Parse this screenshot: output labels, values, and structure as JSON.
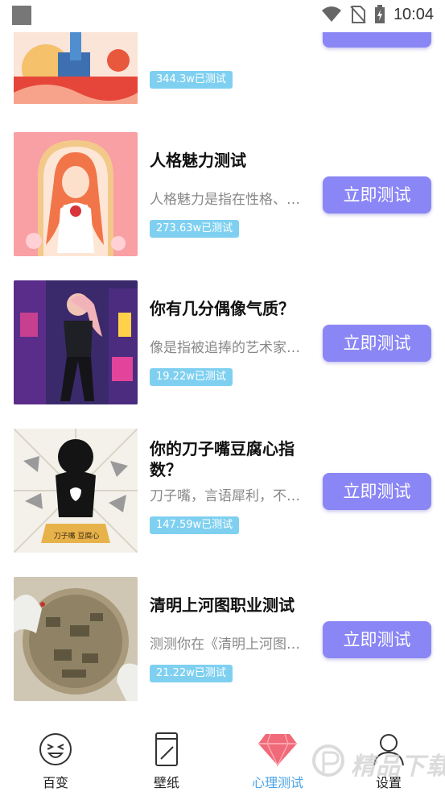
{
  "status_bar": {
    "time": "10:04"
  },
  "tests": [
    {
      "title": "",
      "desc": "",
      "count": "344.3w已测试",
      "button": ""
    },
    {
      "title": "人格魅力测试",
      "desc": "人格魅力是指在性格、…",
      "count": "273.63w已测试",
      "button": "立即测试"
    },
    {
      "title": "你有几分偶像气质？",
      "desc": "像是指被追捧的艺术家…",
      "count": "19.22w已测试",
      "button": "立即测试"
    },
    {
      "title": "你的刀子嘴豆腐心指数？",
      "desc": "刀子嘴，言语犀利，不…",
      "count": "147.59w已测试",
      "button": "立即测试"
    },
    {
      "title": "清明上河图职业测试",
      "desc": "测测你在《清明上河图…",
      "count": "21.22w已测试",
      "button": "立即测试"
    }
  ],
  "thumb_labels": {
    "knife_badge": "刀子嘴 豆腐心"
  },
  "tabs": [
    {
      "label": "百变",
      "icon": "smiley-face-icon"
    },
    {
      "label": "壁纸",
      "icon": "phone-wallpaper-icon"
    },
    {
      "label": "心理测试",
      "icon": "diamond-icon",
      "active": true
    },
    {
      "label": "设置",
      "icon": "person-icon"
    }
  ],
  "watermark": {
    "text": "精品下载"
  },
  "colors": {
    "button": "#8a86f5",
    "badge": "#7fd0f0",
    "active_tab": "#4aa3e8"
  }
}
